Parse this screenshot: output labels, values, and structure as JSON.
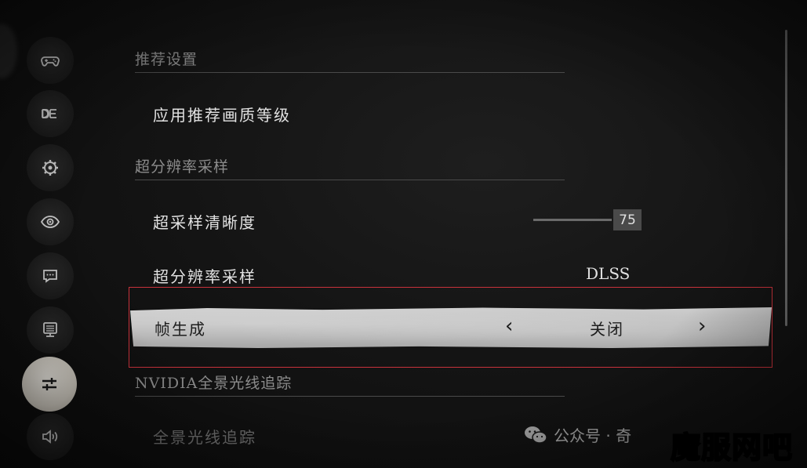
{
  "sections": {
    "recommended": "推荐设置",
    "super_resolution": "超分辨率采样",
    "nvidia": "NVIDIA全景光线追踪"
  },
  "rows": {
    "apply_recommended": "应用推荐画质等级",
    "sharpness_label": "超采样清晰度",
    "sharpness_value": "75",
    "super_resolution_label": "超分辨率采样",
    "super_resolution_value": "DLSS",
    "frame_gen_label": "帧生成",
    "frame_gen_value": "关闭",
    "path_tracing_label": "全景光线追踪"
  },
  "sidebar": {
    "items": [
      "gamepad-icon",
      "text-icon",
      "gear-icon",
      "eye-icon",
      "chat-icon",
      "monitor-icon",
      "sliders-icon",
      "speaker-icon"
    ]
  },
  "watermark": {
    "wechat_text": "公众号 · 奇",
    "site_text": "魔服网吧"
  },
  "colors": {
    "highlight_frame": "#c8323b",
    "selected_bar": "#bdbdbd"
  }
}
